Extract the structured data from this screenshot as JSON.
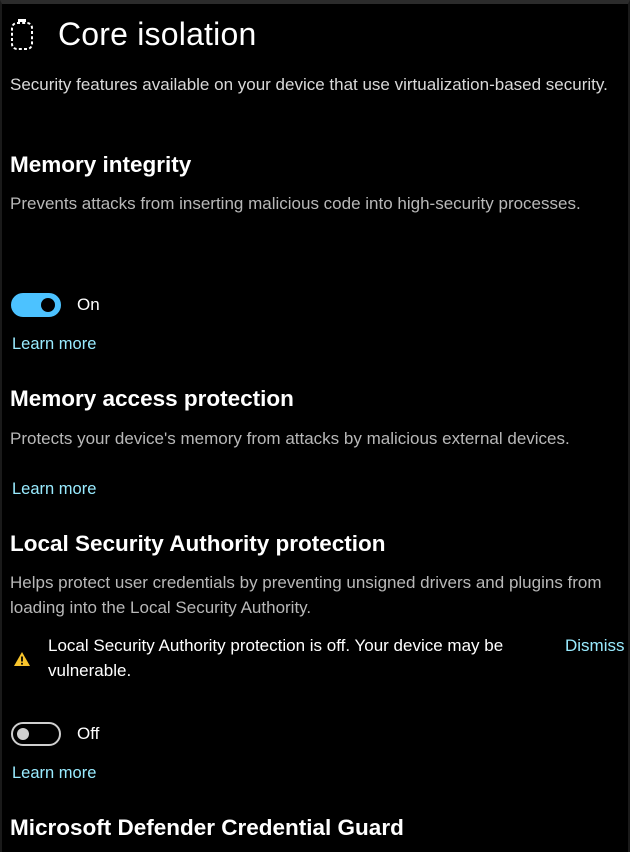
{
  "page": {
    "title": "Core isolation",
    "description": "Security features available on your device that use virtualization-based security."
  },
  "memory_integrity": {
    "title": "Memory integrity",
    "description": "Prevents attacks from inserting malicious code into high-security processes.",
    "toggle_state": "On",
    "learn_more": "Learn more"
  },
  "memory_access": {
    "title": "Memory access protection",
    "description": "Protects your device's memory from attacks by malicious external devices.",
    "learn_more": "Learn more"
  },
  "lsa": {
    "title": "Local Security Authority protection",
    "description": "Helps protect user credentials by preventing unsigned drivers and plugins from loading into the Local Security Authority.",
    "warning_text": "Local Security Authority protection is off. Your device may be vulnerable.",
    "dismiss_label": "Dismiss",
    "toggle_state": "Off",
    "learn_more": "Learn more"
  },
  "credential_guard": {
    "title": "Microsoft Defender Credential Guard"
  },
  "icons": {
    "header": "device-chip-icon",
    "warning": "warning-triangle-icon"
  },
  "colors": {
    "background": "#000000",
    "accent": "#4cc2ff",
    "link": "#99ebff",
    "warning": "#f8c42c"
  }
}
